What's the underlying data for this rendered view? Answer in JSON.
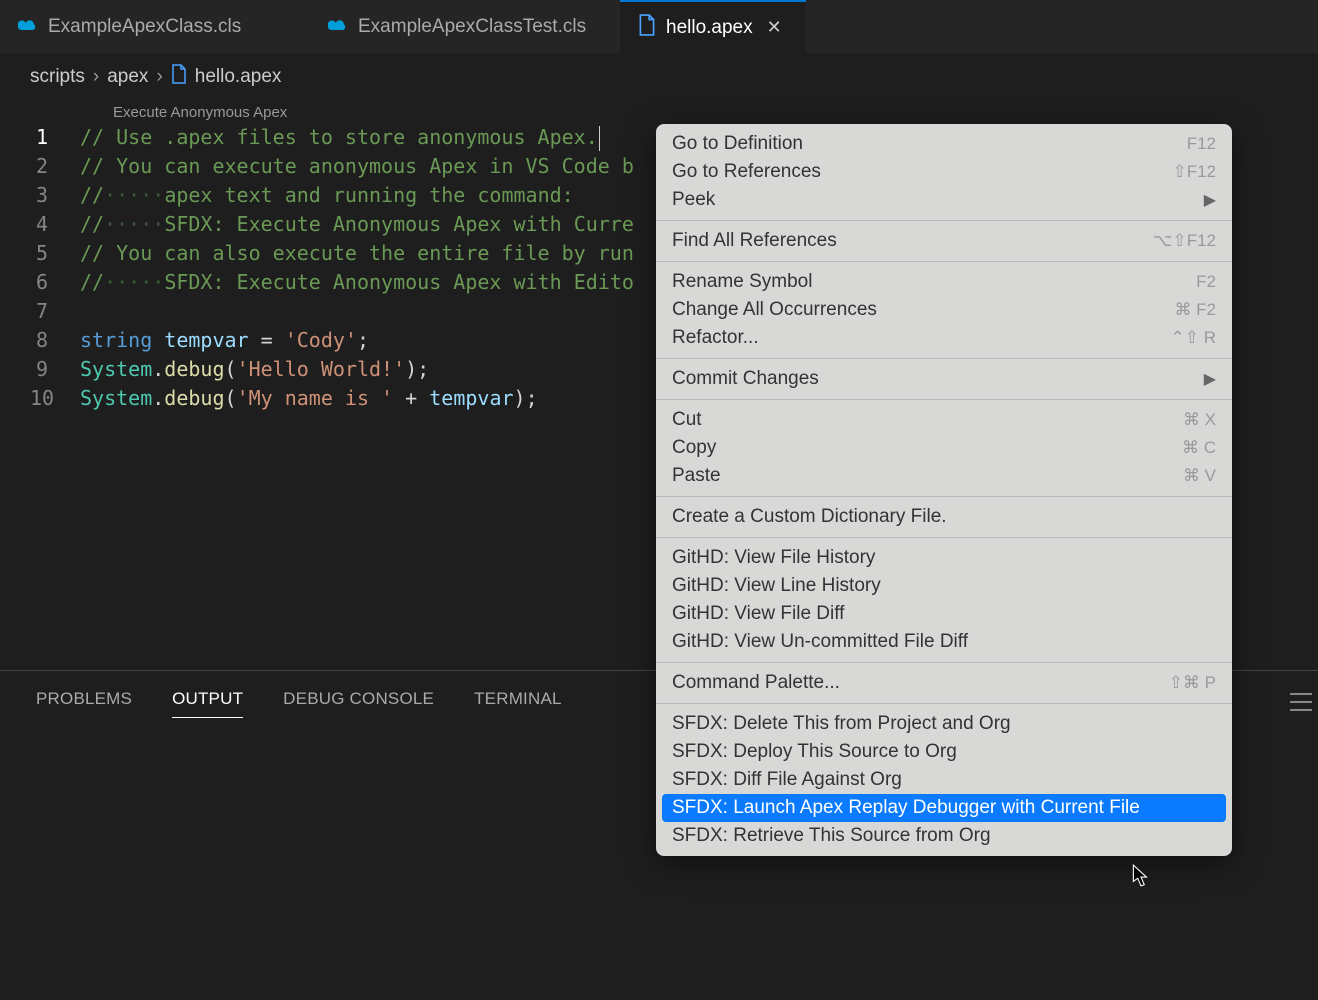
{
  "tabs": [
    {
      "label": "ExampleApexClass.cls",
      "icon": "cloud"
    },
    {
      "label": "ExampleApexClassTest.cls",
      "icon": "cloud"
    },
    {
      "label": "hello.apex",
      "icon": "file",
      "active": true,
      "closeable": true
    }
  ],
  "breadcrumb": {
    "parts": [
      "scripts",
      "apex",
      "hello.apex"
    ]
  },
  "codelens": "Execute Anonymous Apex",
  "code": {
    "lines": [
      {
        "n": 1,
        "comment": "// Use .apex files to store anonymous Apex."
      },
      {
        "n": 2,
        "comment": "// You can execute anonymous Apex in VS Code b"
      },
      {
        "n": 3,
        "comment_pre": "//",
        "dots": "·····",
        "comment_post": "apex text and running the command:"
      },
      {
        "n": 4,
        "comment_pre": "//",
        "dots": "·····",
        "comment_post": "SFDX: Execute Anonymous Apex with Curre"
      },
      {
        "n": 5,
        "comment": "// You can also execute the entire file by run"
      },
      {
        "n": 6,
        "comment_pre": "//",
        "dots": "·····",
        "comment_post": "SFDX: Execute Anonymous Apex with Edito"
      },
      {
        "n": 7,
        "blank": true
      },
      {
        "n": 8,
        "tokens": [
          {
            "cls": "c-keyword",
            "t": "string"
          },
          {
            "cls": "c-punc",
            "t": " "
          },
          {
            "cls": "c-var",
            "t": "tempvar"
          },
          {
            "cls": "c-punc",
            "t": " = "
          },
          {
            "cls": "c-string",
            "t": "'Cody'"
          },
          {
            "cls": "c-punc",
            "t": ";"
          }
        ]
      },
      {
        "n": 9,
        "tokens": [
          {
            "cls": "c-type",
            "t": "System"
          },
          {
            "cls": "c-punc",
            "t": "."
          },
          {
            "cls": "c-method",
            "t": "debug"
          },
          {
            "cls": "c-punc",
            "t": "("
          },
          {
            "cls": "c-string",
            "t": "'Hello World!'"
          },
          {
            "cls": "c-punc",
            "t": ");"
          }
        ]
      },
      {
        "n": 10,
        "tokens": [
          {
            "cls": "c-type",
            "t": "System"
          },
          {
            "cls": "c-punc",
            "t": "."
          },
          {
            "cls": "c-method",
            "t": "debug"
          },
          {
            "cls": "c-punc",
            "t": "("
          },
          {
            "cls": "c-string",
            "t": "'My name is '"
          },
          {
            "cls": "c-punc",
            "t": " + "
          },
          {
            "cls": "c-var",
            "t": "tempvar"
          },
          {
            "cls": "c-punc",
            "t": ");"
          }
        ]
      }
    ]
  },
  "panel": {
    "tabs": [
      "PROBLEMS",
      "OUTPUT",
      "DEBUG CONSOLE",
      "TERMINAL"
    ],
    "active": "OUTPUT"
  },
  "contextMenu": {
    "groups": [
      [
        {
          "label": "Go to Definition",
          "shortcut": "F12"
        },
        {
          "label": "Go to References",
          "shortcut": "⇧F12"
        },
        {
          "label": "Peek",
          "submenu": true
        }
      ],
      [
        {
          "label": "Find All References",
          "shortcut": "⌥⇧F12"
        }
      ],
      [
        {
          "label": "Rename Symbol",
          "shortcut": "F2"
        },
        {
          "label": "Change All Occurrences",
          "shortcut": "⌘ F2"
        },
        {
          "label": "Refactor...",
          "shortcut": "⌃⇧ R"
        }
      ],
      [
        {
          "label": "Commit Changes",
          "submenu": true
        }
      ],
      [
        {
          "label": "Cut",
          "shortcut": "⌘ X"
        },
        {
          "label": "Copy",
          "shortcut": "⌘ C"
        },
        {
          "label": "Paste",
          "shortcut": "⌘ V"
        }
      ],
      [
        {
          "label": "Create a Custom Dictionary File."
        }
      ],
      [
        {
          "label": "GitHD: View File History"
        },
        {
          "label": "GitHD: View Line History"
        },
        {
          "label": "GitHD: View File Diff"
        },
        {
          "label": "GitHD: View Un-committed File Diff"
        }
      ],
      [
        {
          "label": "Command Palette...",
          "shortcut": "⇧⌘ P"
        }
      ],
      [
        {
          "label": "SFDX: Delete This from Project and Org"
        },
        {
          "label": "SFDX: Deploy This Source to Org"
        },
        {
          "label": "SFDX: Diff File Against Org"
        },
        {
          "label": "SFDX: Launch Apex Replay Debugger with Current File",
          "highlight": true
        },
        {
          "label": "SFDX: Retrieve This Source from Org"
        }
      ]
    ]
  }
}
